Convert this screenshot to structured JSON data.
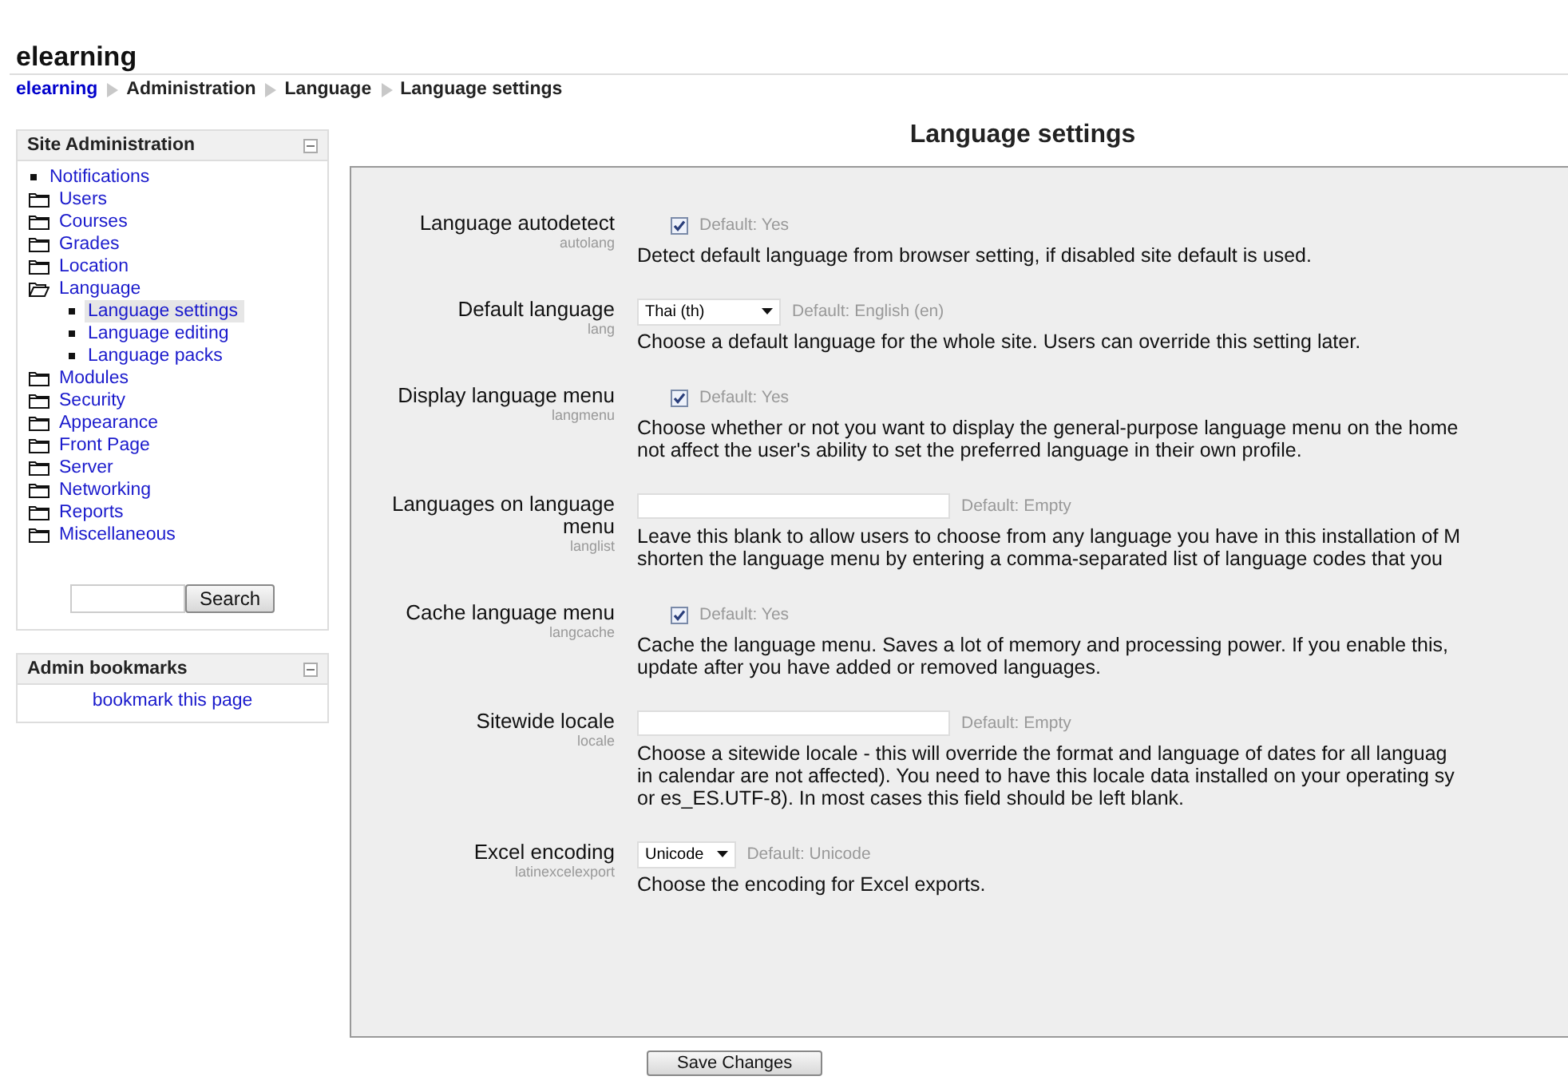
{
  "site_title": "elearning",
  "breadcrumb": [
    {
      "label": "elearning",
      "link": true
    },
    {
      "label": "Administration",
      "link": false
    },
    {
      "label": "Language",
      "link": false
    },
    {
      "label": "Language settings",
      "link": false
    }
  ],
  "sidebar": {
    "title": "Site Administration",
    "items": [
      {
        "label": "Notifications",
        "kind": "leaf",
        "selected": false
      },
      {
        "label": "Users",
        "kind": "folder",
        "expanded": false,
        "selected": false
      },
      {
        "label": "Courses",
        "kind": "folder",
        "expanded": false,
        "selected": false
      },
      {
        "label": "Grades",
        "kind": "folder",
        "expanded": false,
        "selected": false
      },
      {
        "label": "Location",
        "kind": "folder",
        "expanded": false,
        "selected": false
      },
      {
        "label": "Language",
        "kind": "folder",
        "expanded": true,
        "selected": false,
        "children": [
          {
            "label": "Language settings",
            "kind": "leaf",
            "selected": true
          },
          {
            "label": "Language editing",
            "kind": "leaf",
            "selected": false
          },
          {
            "label": "Language packs",
            "kind": "leaf",
            "selected": false
          }
        ]
      },
      {
        "label": "Modules",
        "kind": "folder",
        "expanded": false,
        "selected": false
      },
      {
        "label": "Security",
        "kind": "folder",
        "expanded": false,
        "selected": false
      },
      {
        "label": "Appearance",
        "kind": "folder",
        "expanded": false,
        "selected": false
      },
      {
        "label": "Front Page",
        "kind": "folder",
        "expanded": false,
        "selected": false
      },
      {
        "label": "Server",
        "kind": "folder",
        "expanded": false,
        "selected": false
      },
      {
        "label": "Networking",
        "kind": "folder",
        "expanded": false,
        "selected": false
      },
      {
        "label": "Reports",
        "kind": "folder",
        "expanded": false,
        "selected": false
      },
      {
        "label": "Miscellaneous",
        "kind": "folder",
        "expanded": false,
        "selected": false
      }
    ],
    "search_button": "Search"
  },
  "bookmarks": {
    "title": "Admin bookmarks",
    "link": "bookmark this page"
  },
  "page_title": "Language settings",
  "settings": [
    {
      "kind": "checkbox",
      "label": "Language autodetect",
      "name": "autolang",
      "checked": true,
      "default": "Default: Yes",
      "description": [
        "Detect default language from browser setting, if disabled site default is used."
      ]
    },
    {
      "kind": "select",
      "label": "Default language",
      "name": "lang",
      "value": "Thai (th)",
      "default": "Default: English (en)",
      "description": [
        "Choose a default language for the whole site. Users can override this setting later."
      ]
    },
    {
      "kind": "checkbox",
      "label": "Display language menu",
      "name": "langmenu",
      "checked": true,
      "default": "Default: Yes",
      "description": [
        "Choose whether or not you want to display the general-purpose language menu on the home",
        "not affect the user's ability to set the preferred language in their own profile."
      ]
    },
    {
      "kind": "text",
      "label": "Languages on language menu",
      "name": "langlist",
      "default": "Default: Empty",
      "description": [
        "Leave this blank to allow users to choose from any language you have in this installation of M",
        "shorten the language menu by entering a comma-separated list of language codes that you"
      ]
    },
    {
      "kind": "checkbox",
      "label": "Cache language menu",
      "name": "langcache",
      "checked": true,
      "default": "Default: Yes",
      "description": [
        "Cache the language menu. Saves a lot of memory and processing power. If you enable this,",
        "update after you have added or removed languages."
      ]
    },
    {
      "kind": "text",
      "label": "Sitewide locale",
      "name": "locale",
      "default": "Default: Empty",
      "description": [
        "Choose a sitewide locale - this will override the format and language of dates for all languag",
        "in calendar are not affected). You need to have this locale data installed on your operating sy",
        "or es_ES.UTF-8). In most cases this field should be left blank."
      ]
    },
    {
      "kind": "select",
      "label": "Excel encoding",
      "name": "latinexcelexport",
      "value": "Unicode",
      "default": "Default: Unicode",
      "description": [
        "Choose the encoding for Excel exports."
      ]
    }
  ],
  "save_button": "Save Changes"
}
